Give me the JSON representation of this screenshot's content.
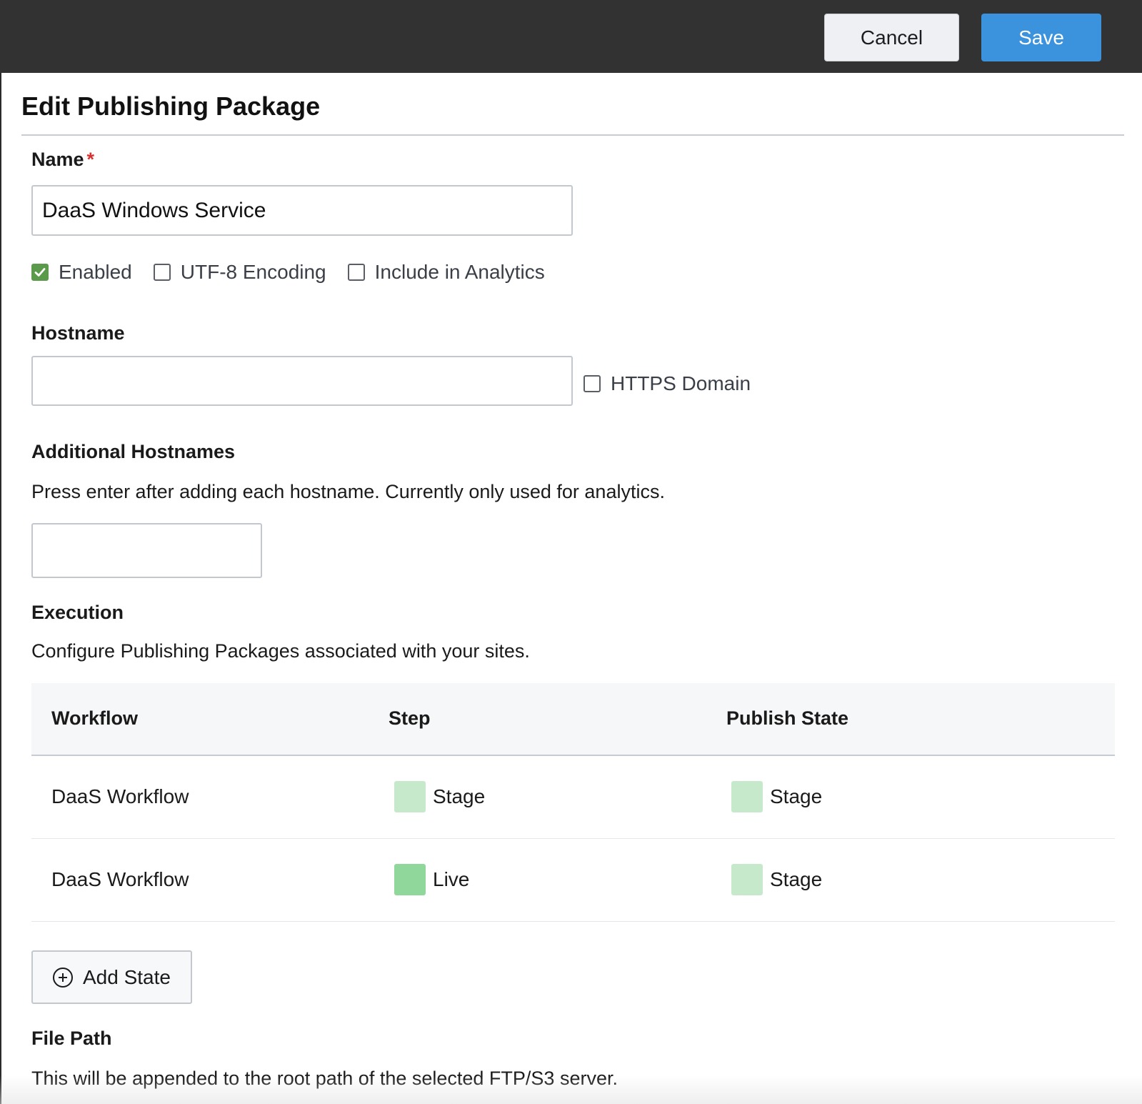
{
  "header": {
    "cancel_label": "Cancel",
    "save_label": "Save"
  },
  "page": {
    "title": "Edit Publishing Package"
  },
  "name_field": {
    "label": "Name",
    "required_mark": "*",
    "value": "DaaS Windows Service"
  },
  "options": {
    "enabled": {
      "label": "Enabled",
      "checked": true
    },
    "utf8": {
      "label": "UTF-8 Encoding",
      "checked": false
    },
    "analytics": {
      "label": "Include in Analytics",
      "checked": false
    }
  },
  "hostname": {
    "label": "Hostname",
    "value": "",
    "https_label": "HTTPS Domain",
    "https_checked": false
  },
  "additional_hostnames": {
    "label": "Additional Hostnames",
    "help": "Press enter after adding each hostname. Currently only used for analytics.",
    "value": ""
  },
  "execution": {
    "label": "Execution",
    "help": "Configure Publishing Packages associated with your sites.",
    "columns": [
      "Workflow",
      "Step",
      "Publish State"
    ],
    "rows": [
      {
        "workflow": "DaaS Workflow",
        "step": "Stage",
        "step_color": "#c6e9cc",
        "publish_state": "Stage",
        "publish_color": "#c6e9cc"
      },
      {
        "workflow": "DaaS Workflow",
        "step": "Live",
        "step_color": "#8fd79a",
        "publish_state": "Stage",
        "publish_color": "#c6e9cc"
      }
    ],
    "add_state_label": "Add State"
  },
  "file_path": {
    "label": "File Path",
    "help": "This will be appended to the root path of the selected FTP/S3 server."
  },
  "colors": {
    "topbar": "#323232",
    "save": "#3b92dd",
    "checked": "#5a9a4a",
    "required": "#d9322e"
  }
}
